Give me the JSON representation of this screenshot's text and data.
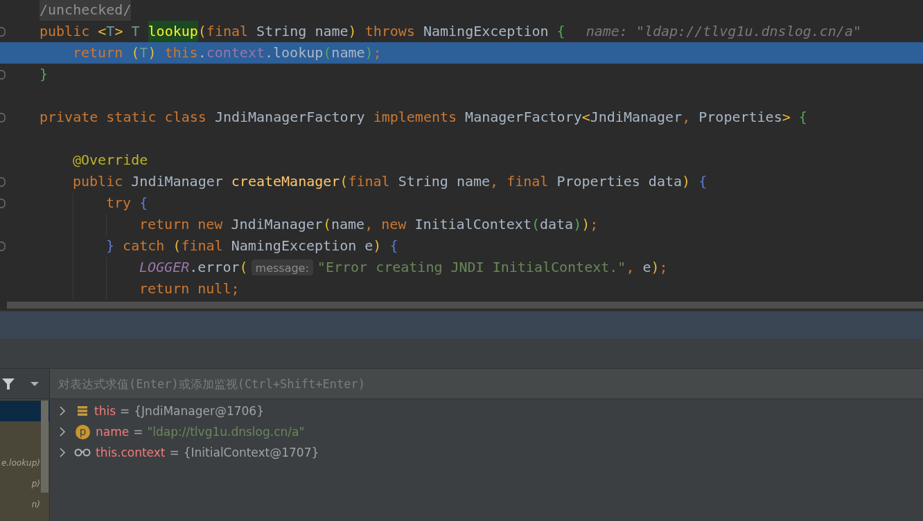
{
  "editor": {
    "lines": [
      {
        "selected": false,
        "fold": false,
        "tokens": [
          {
            "kind": "comment",
            "t": "/unchecked/"
          }
        ]
      },
      {
        "selected": false,
        "fold": true,
        "tokens": [
          {
            "kind": "kw",
            "t": "public "
          },
          {
            "kind": "p1",
            "t": "<"
          },
          {
            "kind": "tparam",
            "t": "T"
          },
          {
            "kind": "p1",
            "t": ">"
          },
          {
            "kind": "tparam",
            "t": " T "
          },
          {
            "kind": "match",
            "t": "lookup"
          },
          {
            "kind": "p1",
            "t": "("
          },
          {
            "kind": "kw",
            "t": "final "
          },
          {
            "kind": "plain",
            "t": "String name"
          },
          {
            "kind": "p1",
            "t": ")"
          },
          {
            "kind": "kw",
            "t": " throws "
          },
          {
            "kind": "plain",
            "t": "NamingException "
          },
          {
            "kind": "p2",
            "t": "{"
          },
          {
            "kind": "hint",
            "t": "name: \"ldap://tlvg1u.dnslog.cn/a\""
          }
        ],
        "children": [
          {
            "selected": true,
            "fold": false,
            "tokens": [
              {
                "kind": "kw",
                "t": "return "
              },
              {
                "kind": "p1",
                "t": "("
              },
              {
                "kind": "tparam",
                "t": "T"
              },
              {
                "kind": "p1",
                "t": ")"
              },
              {
                "kind": "kw",
                "t": " this"
              },
              {
                "kind": "plain",
                "t": "."
              },
              {
                "kind": "field",
                "t": "context"
              },
              {
                "kind": "plain",
                "t": ".lookup"
              },
              {
                "kind": "p2",
                "t": "("
              },
              {
                "kind": "plain",
                "t": "name"
              },
              {
                "kind": "p2",
                "t": ")"
              },
              {
                "kind": "kw",
                "t": ";"
              }
            ]
          }
        ]
      },
      {
        "selected": false,
        "fold": true,
        "tokens": [
          {
            "kind": "p2",
            "t": "}"
          }
        ]
      },
      {
        "selected": false,
        "fold": false
      },
      {
        "selected": false,
        "fold": true,
        "tokens": [
          {
            "kind": "kw",
            "t": "private static class "
          },
          {
            "kind": "plain",
            "t": "JndiManagerFactory "
          },
          {
            "kind": "kw",
            "t": "implements "
          },
          {
            "kind": "plain",
            "t": "ManagerFactory"
          },
          {
            "kind": "p1",
            "t": "<"
          },
          {
            "kind": "plain",
            "t": "JndiManager"
          },
          {
            "kind": "kw",
            "t": ", "
          },
          {
            "kind": "plain",
            "t": "Properties"
          },
          {
            "kind": "p1",
            "t": ">"
          },
          {
            "kind": "p2",
            "t": " {"
          }
        ],
        "children": [
          {
            "selected": false,
            "fold": false
          },
          {
            "selected": false,
            "fold": false,
            "tokens": [
              {
                "kind": "annot",
                "t": "@Override"
              }
            ]
          },
          {
            "selected": false,
            "fold": true,
            "tokens": [
              {
                "kind": "kw",
                "t": "public "
              },
              {
                "kind": "plain",
                "t": "JndiManager "
              },
              {
                "kind": "method",
                "t": "createManager"
              },
              {
                "kind": "p1",
                "t": "("
              },
              {
                "kind": "kw",
                "t": "final "
              },
              {
                "kind": "plain",
                "t": "String name"
              },
              {
                "kind": "kw",
                "t": ", final "
              },
              {
                "kind": "plain",
                "t": "Properties data"
              },
              {
                "kind": "p1",
                "t": ")"
              },
              {
                "kind": "p3",
                "t": " {"
              }
            ],
            "children": [
              {
                "selected": false,
                "fold": true,
                "tokens": [
                  {
                    "kind": "kw",
                    "t": "try "
                  },
                  {
                    "kind": "p3",
                    "t": "{"
                  }
                ],
                "children": [
                  {
                    "selected": false,
                    "fold": false,
                    "tokens": [
                      {
                        "kind": "kw",
                        "t": "return new "
                      },
                      {
                        "kind": "plain",
                        "t": "JndiManager"
                      },
                      {
                        "kind": "p1",
                        "t": "("
                      },
                      {
                        "kind": "plain",
                        "t": "name"
                      },
                      {
                        "kind": "kw",
                        "t": ", new "
                      },
                      {
                        "kind": "plain",
                        "t": "InitialContext"
                      },
                      {
                        "kind": "p2",
                        "t": "("
                      },
                      {
                        "kind": "plain",
                        "t": "data"
                      },
                      {
                        "kind": "p2",
                        "t": ")"
                      },
                      {
                        "kind": "p1",
                        "t": ")"
                      },
                      {
                        "kind": "kw",
                        "t": ";"
                      }
                    ]
                  }
                ]
              },
              {
                "selected": false,
                "fold": true,
                "tokens": [
                  {
                    "kind": "p3",
                    "t": "}"
                  },
                  {
                    "kind": "kw",
                    "t": " catch "
                  },
                  {
                    "kind": "p1",
                    "t": "("
                  },
                  {
                    "kind": "kw",
                    "t": "final "
                  },
                  {
                    "kind": "plain",
                    "t": "NamingException e"
                  },
                  {
                    "kind": "p1",
                    "t": ")"
                  },
                  {
                    "kind": "p3",
                    "t": " {"
                  }
                ],
                "children": [
                  {
                    "selected": false,
                    "fold": false,
                    "tokens": [
                      {
                        "kind": "static",
                        "t": "LOGGER"
                      },
                      {
                        "kind": "plain",
                        "t": ".error"
                      },
                      {
                        "kind": "p1",
                        "t": "("
                      },
                      {
                        "kind": "inlay",
                        "t": "message:"
                      },
                      {
                        "kind": "string",
                        "t": "\"Error creating JNDI InitialContext.\""
                      },
                      {
                        "kind": "kw",
                        "t": ", "
                      },
                      {
                        "kind": "plain",
                        "t": "e"
                      },
                      {
                        "kind": "p1",
                        "t": ")"
                      },
                      {
                        "kind": "kw",
                        "t": ";"
                      }
                    ]
                  },
                  {
                    "selected": false,
                    "fold": false,
                    "tokens": [
                      {
                        "kind": "kw",
                        "t": "return null;"
                      }
                    ]
                  }
                ]
              }
            ]
          }
        ]
      }
    ]
  },
  "debugger": {
    "eval_field": {
      "placeholder": "对表达式求值(Enter)或添加监视(Ctrl+Shift+Enter)"
    },
    "frames": [
      {
        "selected": true
      },
      {
        "text": "e.lookup)",
        "selected": false
      },
      {
        "text": "p)",
        "selected": false
      },
      {
        "text": "n)",
        "selected": false
      }
    ],
    "variables": [
      {
        "kind": "object",
        "name": "this",
        "separator": "=",
        "value": "{JndiManager@1706}"
      },
      {
        "kind": "param",
        "icon_text": "p",
        "name": "name",
        "separator": "=",
        "value": "\"ldap://tlvg1u.dnslog.cn/a\""
      },
      {
        "kind": "watch",
        "name": "this.context",
        "separator": "=",
        "value": "{InitialContext@1707}"
      }
    ]
  }
}
